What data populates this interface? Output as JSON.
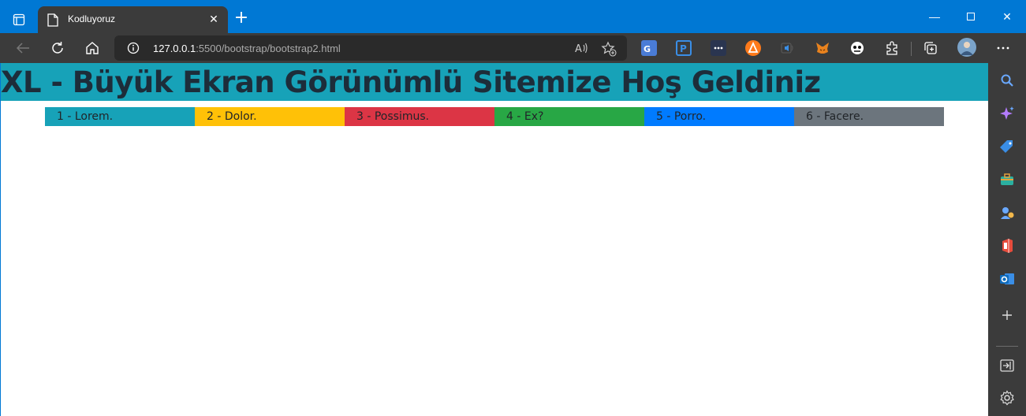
{
  "browser": {
    "tab_title": "Kodluyoruz",
    "url_host": "127.0.0.1",
    "url_rest": ":5500/bootstrap/bootstrap2.html",
    "read_aloud_icon": "read-aloud-icon",
    "favorite_icon": "add-favorite-icon",
    "extensions": [
      "translate-icon",
      "p-extension-icon",
      "dots-extension-icon",
      "avast-icon",
      "audio-extension-icon",
      "metamask-fox-icon",
      "ghost-extension-icon",
      "puzzle-extensions-icon"
    ],
    "collections_icon": "collections-icon",
    "more_icon": "more-dots-icon"
  },
  "page": {
    "heading": "XL - Büyük Ekran Görünümlü Sitemize Hoş Geldiniz",
    "heading_bg": "#17a2b8",
    "columns": [
      {
        "label": "1 - Lorem.",
        "color": "#17a2b8"
      },
      {
        "label": "2 - Dolor.",
        "color": "#ffc107"
      },
      {
        "label": "3 - Possimus.",
        "color": "#dc3545"
      },
      {
        "label": "4 - Ex?",
        "color": "#28a745"
      },
      {
        "label": "5 - Porro.",
        "color": "#007bff"
      },
      {
        "label": "6 - Facere.",
        "color": "#6c757d"
      }
    ]
  },
  "sidebar": {
    "items": [
      "search-icon",
      "copilot-icon",
      "shopping-tag-icon",
      "tools-briefcase-icon",
      "games-icon",
      "office-icon",
      "outlook-icon",
      "add-icon"
    ],
    "bottom": [
      "hide-sidebar-icon",
      "settings-icon"
    ]
  }
}
